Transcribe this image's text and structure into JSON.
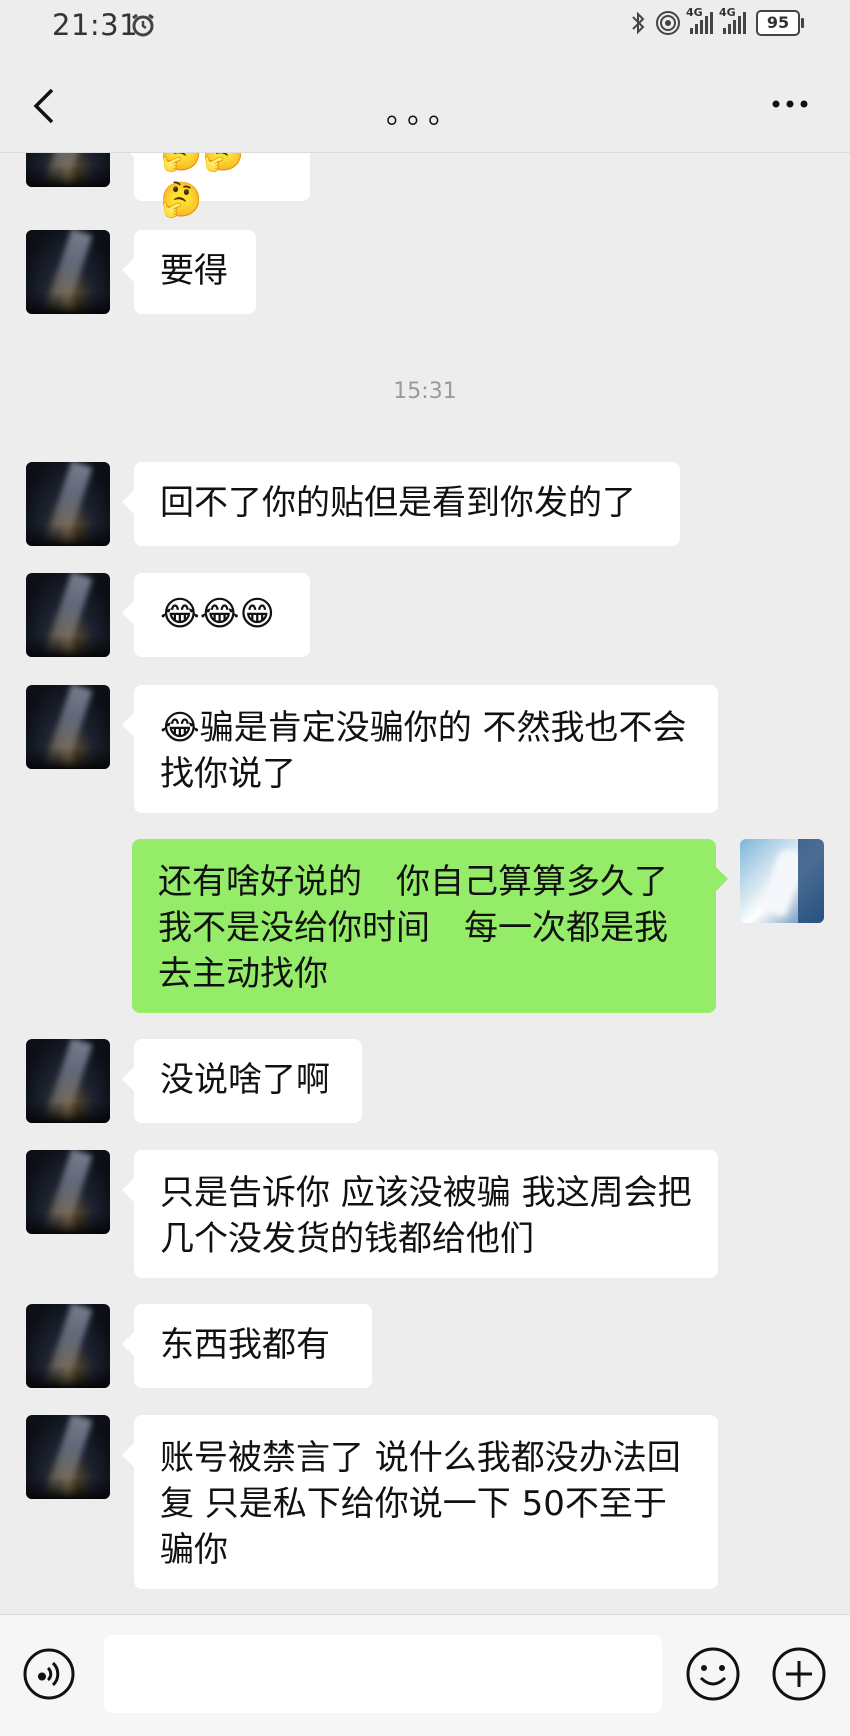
{
  "status_bar": {
    "time": "21:31",
    "network_1": "4G",
    "network_2": "4G",
    "battery": "95"
  },
  "nav": {
    "title": "。。。"
  },
  "chat": {
    "timestamp": "15:31",
    "messages": [
      {
        "from": "other",
        "text": "🤔🤔🤔"
      },
      {
        "from": "other",
        "text": "要得"
      },
      {
        "from": "other",
        "text": "回不了你的贴但是看到你发的了"
      },
      {
        "from": "other",
        "text": "😂😂😁"
      },
      {
        "from": "other",
        "text": "😂骗是肯定没骗你的 不然我也不会找你说了"
      },
      {
        "from": "me",
        "text": "还有啥好说的　你自己算算多久了　我不是没给你时间　每一次都是我去主动找你"
      },
      {
        "from": "other",
        "text": "没说啥了啊"
      },
      {
        "from": "other",
        "text": "只是告诉你 应该没被骗 我这周会把几个没发货的钱都给他们"
      },
      {
        "from": "other",
        "text": "东西我都有"
      },
      {
        "from": "other",
        "text": "账号被禁言了 说什么我都没办法回复 只是私下给你说一下 50不至于骗你"
      }
    ]
  },
  "input_bar": {
    "value": "",
    "placeholder": ""
  }
}
